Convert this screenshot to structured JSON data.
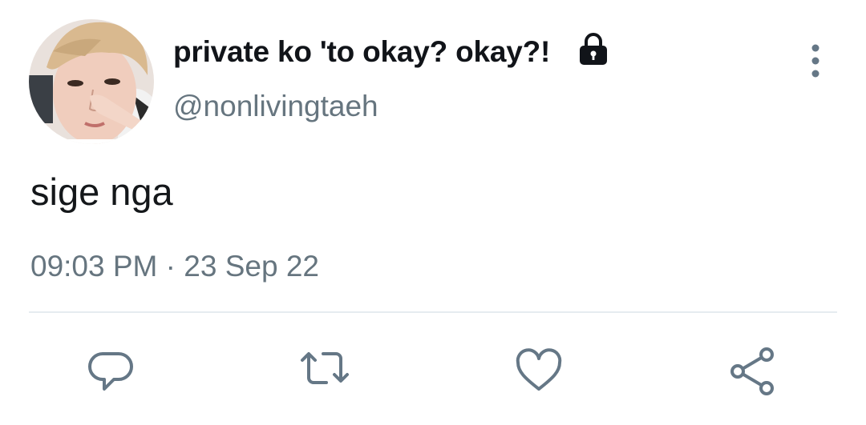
{
  "tweet": {
    "author": {
      "display_name": "private ko 'to okay? okay?!",
      "handle": "@nonlivingtaeh",
      "protected_icon": "lock-icon"
    },
    "text": "sige nga",
    "time": "09:03 PM",
    "separator": "·",
    "date": "23 Sep 22"
  },
  "actions": {
    "reply_icon": "speech-bubble-icon",
    "retweet_icon": "retweet-icon",
    "like_icon": "heart-icon",
    "share_icon": "share-icon",
    "more_icon": "vertical-ellipsis-icon"
  },
  "colors": {
    "name": "#111419",
    "secondary": "#66757f",
    "icon": "#657786",
    "divider": "#e6ecf0"
  }
}
